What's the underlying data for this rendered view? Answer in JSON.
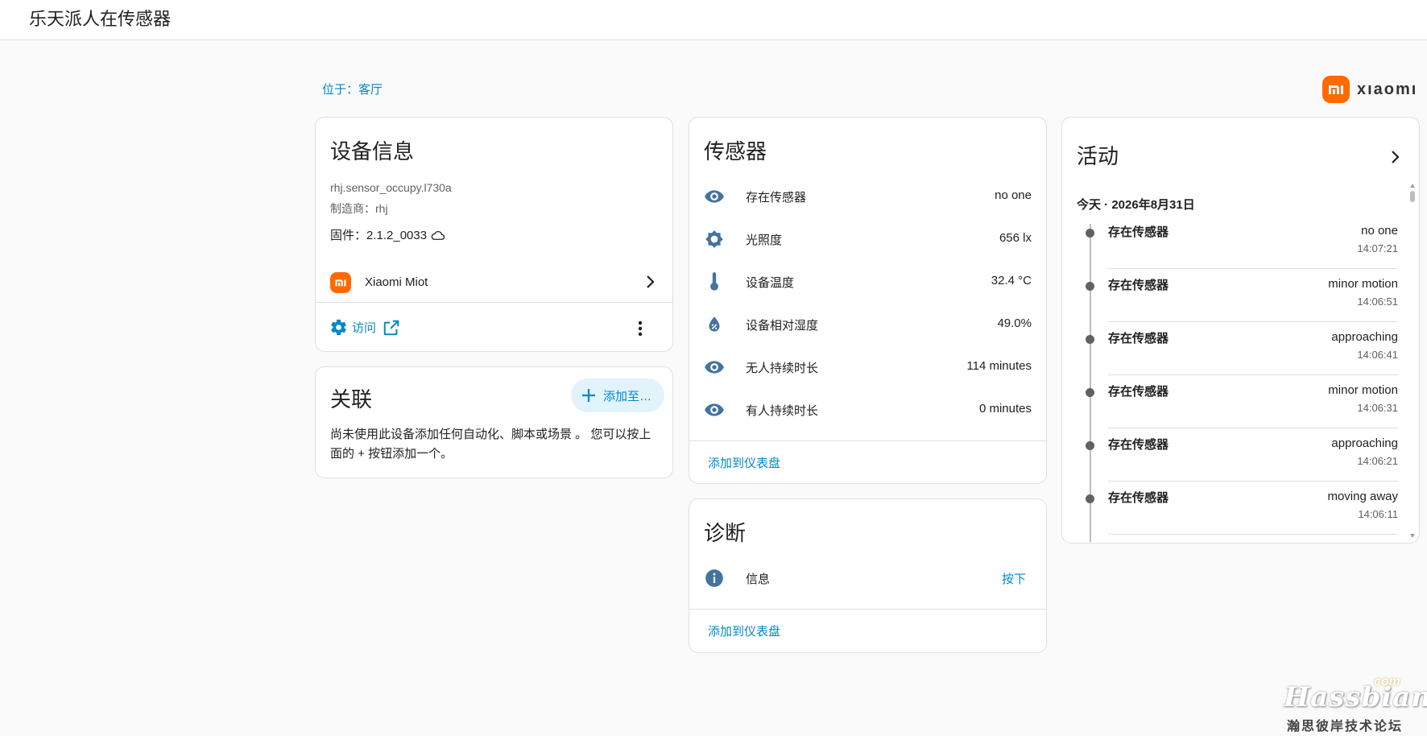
{
  "header": {
    "title": "乐天派人在传感器"
  },
  "area": {
    "label": "位于：客厅"
  },
  "brand": {
    "logo_text": "mi",
    "wordmark": "xıaomı",
    "color": "#ff6900"
  },
  "device_info": {
    "title": "设备信息",
    "model": "rhj.sensor_occupy.l730a",
    "manufacturer": "制造商：rhj",
    "firmware": "固件：2.1.2_0033",
    "integration": "Xiaomi Miot",
    "visit_label": "访问"
  },
  "related": {
    "title": "关联",
    "add_button": "添加至…",
    "description": "尚未使用此设备添加任何自动化、脚本或场景 。 您可以按上面的 + 按钮添加一个。"
  },
  "sensors": {
    "title": "传感器",
    "items": [
      {
        "icon": "eye-icon",
        "name": "存在传感器",
        "value": "no one"
      },
      {
        "icon": "brightness-icon",
        "name": "光照度",
        "value": "656 lx"
      },
      {
        "icon": "thermometer-icon",
        "name": "设备温度",
        "value": "32.4 °C"
      },
      {
        "icon": "water-percent-icon",
        "name": "设备相对湿度",
        "value": "49.0%"
      },
      {
        "icon": "eye-icon",
        "name": "无人持续时长",
        "value": "114 minutes"
      },
      {
        "icon": "eye-icon",
        "name": "有人持续时长",
        "value": "0 minutes"
      }
    ],
    "add_to_dashboard": "添加到仪表盘"
  },
  "diagnostics": {
    "title": "诊断",
    "items": [
      {
        "icon": "info-icon",
        "name": "信息",
        "action": "按下"
      }
    ],
    "add_to_dashboard": "添加到仪表盘"
  },
  "activity": {
    "title": "活动",
    "date": "今天 · 2026年8月31日",
    "events": [
      {
        "name": "存在传感器",
        "state": "no one",
        "time": "14:07:21"
      },
      {
        "name": "存在传感器",
        "state": "minor motion",
        "time": "14:06:51"
      },
      {
        "name": "存在传感器",
        "state": "approaching",
        "time": "14:06:41"
      },
      {
        "name": "存在传感器",
        "state": "minor motion",
        "time": "14:06:31"
      },
      {
        "name": "存在传感器",
        "state": "approaching",
        "time": "14:06:21"
      },
      {
        "name": "存在传感器",
        "state": "moving away",
        "time": "14:06:11"
      }
    ]
  },
  "watermark": {
    "logo": "Hassbian",
    "suffix": "com",
    "subtitle": "瀚思彼岸技术论坛"
  },
  "colors": {
    "accent": "#0288c7",
    "icon": "#44739e",
    "brand": "#ff6900"
  }
}
